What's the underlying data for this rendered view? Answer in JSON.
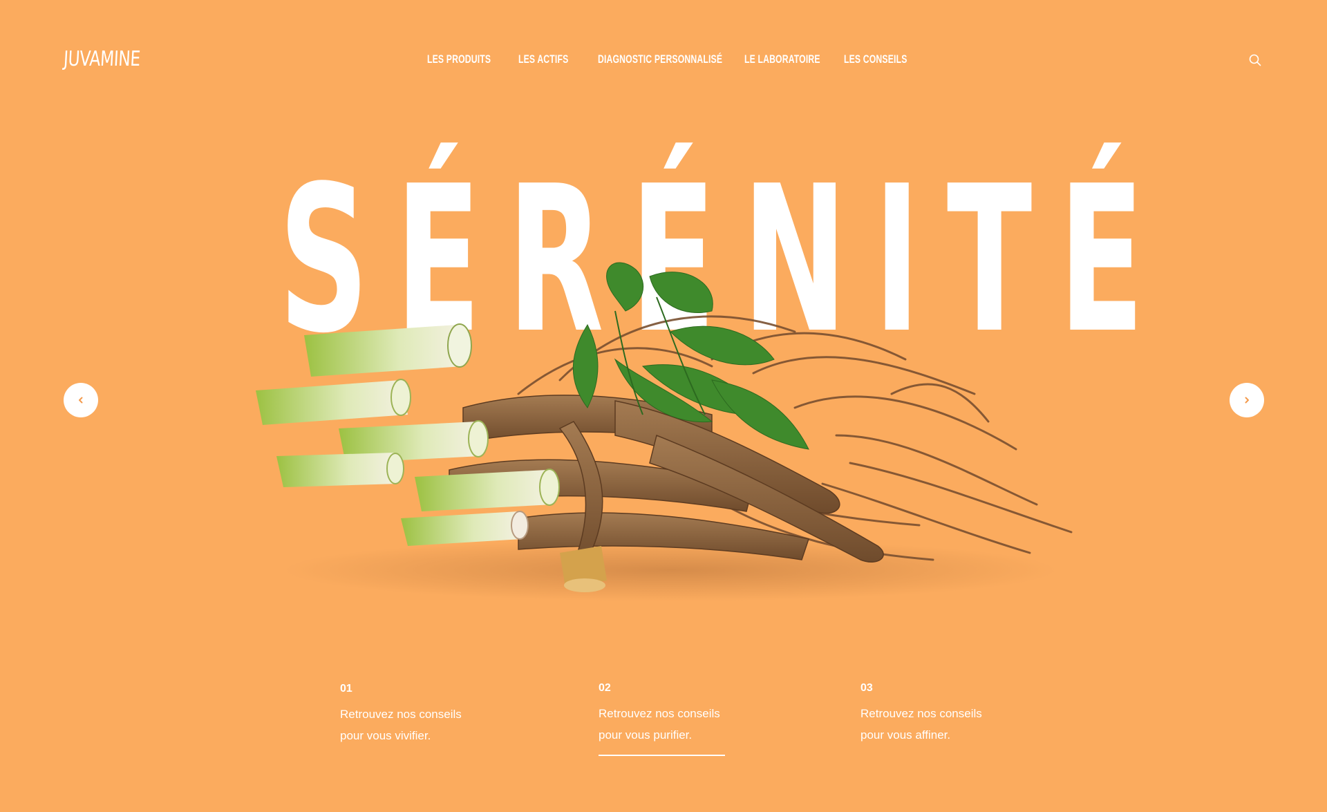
{
  "brand": {
    "logo_text": "JUVAMINE"
  },
  "nav": {
    "items": [
      {
        "label": "LES PRODUITS"
      },
      {
        "label": "LES ACTIFS"
      },
      {
        "label": "DIAGNOSTIC PERSONNALISÉ"
      },
      {
        "label": "LE LABORATOIRE"
      },
      {
        "label": "LES CONSEILS"
      }
    ],
    "search_icon": "search-icon"
  },
  "hero": {
    "title": "SÉRÉNITÉ",
    "image_subject": "ginseng roots with green leaves",
    "prev_icon": "chevron-left-icon",
    "next_icon": "chevron-right-icon"
  },
  "slides": [
    {
      "number": "01",
      "line1": "Retrouvez nos conseils",
      "line2": "pour vous vivifier.",
      "active": false
    },
    {
      "number": "02",
      "line1": "Retrouvez nos conseils",
      "line2": "pour vous purifier.",
      "active": true
    },
    {
      "number": "03",
      "line1": "Retrouvez nos conseils",
      "line2": "pour vous affiner.",
      "active": false
    }
  ],
  "colors": {
    "background": "#fbab5e",
    "text": "#ffffff",
    "arrow_icon": "#f39a4c"
  }
}
